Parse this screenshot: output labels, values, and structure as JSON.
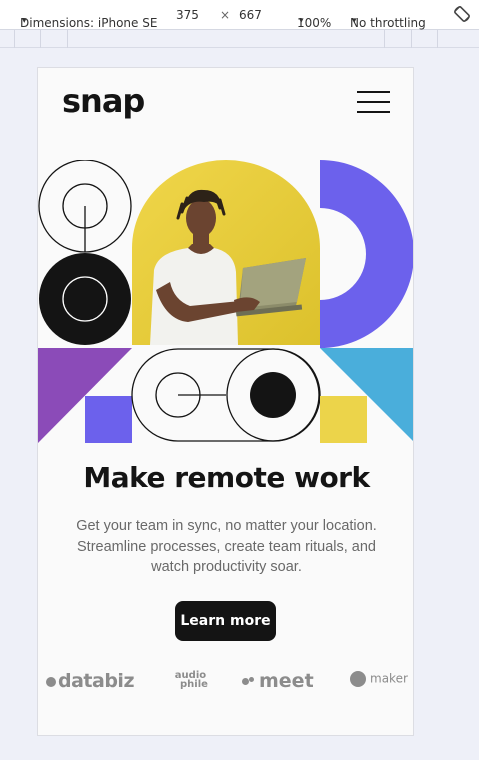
{
  "devtools": {
    "dimensions_label": "Dimensions: iPhone SE",
    "width": "375",
    "times": "×",
    "height": "667",
    "zoom": "100%",
    "throttling": "No throttling",
    "caret": "▾"
  },
  "page": {
    "logo": "snap",
    "headline": "Make remote work",
    "description": "Get your team in sync, no matter your location. Streamline processes, create team rituals, and watch productivity soar.",
    "cta_label": "Learn more",
    "clients": [
      "databiz",
      "audio phile",
      "meet",
      "maker"
    ],
    "audiophile_top": "audio",
    "audiophile_bottom": "phile"
  },
  "colors": {
    "purple": "#6c61ec",
    "yellow": "#ecd44a",
    "blue": "#4aaedb",
    "violet": "#8b4bb8",
    "ink": "#141414"
  }
}
